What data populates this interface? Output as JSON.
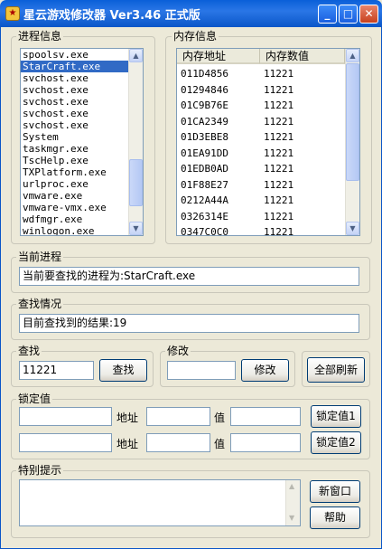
{
  "window": {
    "title": "星云游戏修改器 Ver3.46 正式版",
    "icon": "app-icon"
  },
  "process_info": {
    "label": "进程信息",
    "items": [
      "spoolsv.exe",
      "StarCraft.exe",
      "svchost.exe",
      "svchost.exe",
      "svchost.exe",
      "svchost.exe",
      "svchost.exe",
      "System",
      "taskmgr.exe",
      "TscHelp.exe",
      "TXPlatform.exe",
      "urlproc.exe",
      "vmware.exe",
      "vmware-vmx.exe",
      "wdfmgr.exe",
      "winlogon.exe"
    ],
    "selected_index": 1
  },
  "memory_info": {
    "label": "内存信息",
    "columns": [
      "内存地址",
      "内存数值"
    ],
    "rows": [
      [
        "011D4856",
        "11221"
      ],
      [
        "01294846",
        "11221"
      ],
      [
        "01C9B76E",
        "11221"
      ],
      [
        "01CA2349",
        "11221"
      ],
      [
        "01D3EBE8",
        "11221"
      ],
      [
        "01EA91DD",
        "11221"
      ],
      [
        "01EDB0AD",
        "11221"
      ],
      [
        "01F88E27",
        "11221"
      ],
      [
        "0212A44A",
        "11221"
      ],
      [
        "0326314E",
        "11221"
      ],
      [
        "0347C0C0",
        "11221"
      ]
    ]
  },
  "current_process": {
    "label": "当前进程",
    "text": "当前要查找的进程为:StarCraft.exe"
  },
  "search_status": {
    "label": "查找情况",
    "text": "目前查找到的结果:19"
  },
  "search": {
    "label": "查找",
    "value": "11221",
    "button": "查找"
  },
  "modify": {
    "label": "修改",
    "value": "",
    "button": "修改"
  },
  "refresh_button": "全部刷新",
  "lock": {
    "label": "锁定值",
    "rows": [
      {
        "address_label": "地址",
        "value_label": "值",
        "button": "锁定值1"
      },
      {
        "address_label": "地址",
        "value_label": "值",
        "button": "锁定值2"
      }
    ]
  },
  "special": {
    "label": "特别提示",
    "text": "",
    "new_window_button": "新窗口",
    "help_button": "帮助"
  },
  "colors": {
    "titlebar": "#0a5fd8",
    "selection": "#316ac5",
    "face": "#ece9d8"
  }
}
